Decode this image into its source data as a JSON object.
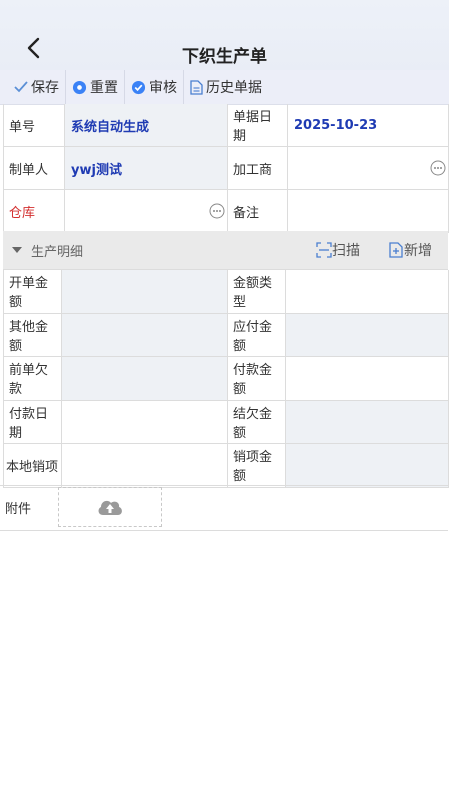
{
  "header": {
    "title": "下织生产单"
  },
  "toolbar": {
    "save": "保存",
    "reset": "重置",
    "audit": "审核",
    "history": "历史单据"
  },
  "form": {
    "order_no_label": "单号",
    "order_no_value": "系统自动生成",
    "order_date_label": "单据日期",
    "order_date_value": "2025-10-23",
    "maker_label": "制单人",
    "maker_value": "ywj测试",
    "processor_label": "加工商",
    "warehouse_label": "仓库",
    "remark_label": "备注"
  },
  "section": {
    "title": "生产明细",
    "scan": "扫描",
    "add": "新增"
  },
  "finance": {
    "opening_amount": "开单金额",
    "amount_type": "金额类型",
    "other_amount": "其他金额",
    "payable_amount": "应付金额",
    "prev_debt": "前单欠款",
    "paid_amount": "付款金额",
    "pay_date": "付款日期",
    "outstanding_amount": "结欠金额",
    "local_writeoff": "本地销项",
    "writeoff_amount": "销项金额"
  },
  "attachment": {
    "label": "附件"
  },
  "colors": {
    "accent": "#3b82f6",
    "blue_text": "#1f3bb3",
    "required": "#d32f2f"
  }
}
